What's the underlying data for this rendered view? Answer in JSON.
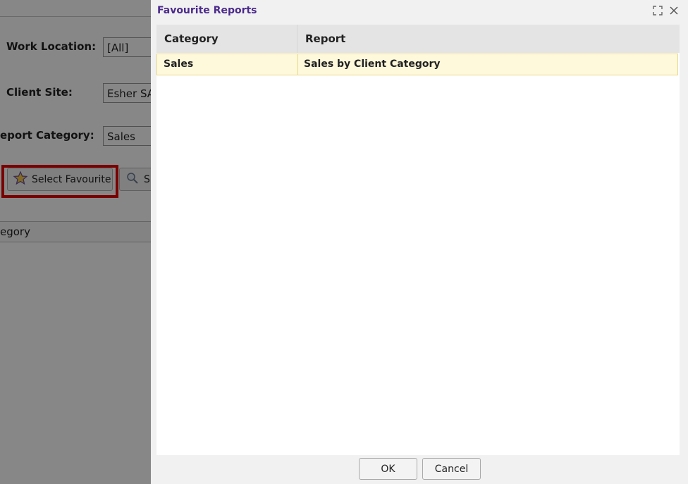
{
  "background": {
    "work_location_label": "Work Location:",
    "work_location_value": "[All]",
    "client_site_label": "Client Site:",
    "client_site_value": "Esher SA",
    "report_category_label": "eport Category:",
    "report_category_value": "Sales",
    "select_favourite_button": "Select Favourite",
    "second_button_label": "S",
    "grid_header": "egory",
    "icons": {
      "favourite": "star-icon",
      "second": "search-gear-icon"
    },
    "highlight_color": "#e60000"
  },
  "dialog": {
    "title": "Favourite Reports",
    "title_color": "#4b2a8c",
    "controls": {
      "maximize": "maximize-icon",
      "close": "close-icon"
    },
    "table": {
      "columns": [
        "Category",
        "Report"
      ],
      "rows": [
        {
          "category": "Sales",
          "report": "Sales by Client Category",
          "selected": true
        }
      ],
      "selected_row_color": "#fff9dc"
    },
    "buttons": {
      "ok": "OK",
      "cancel": "Cancel"
    }
  }
}
